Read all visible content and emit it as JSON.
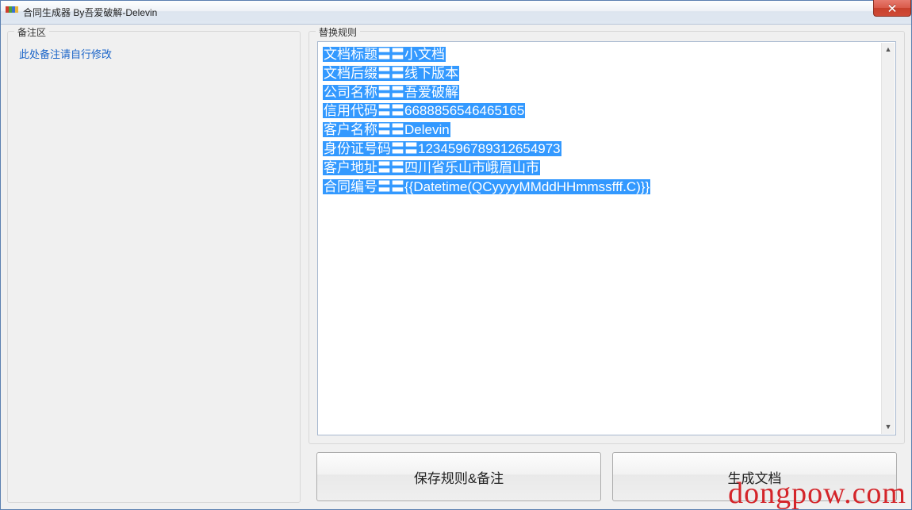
{
  "window": {
    "title": "合同生成器    By吾爱破解-Delevin"
  },
  "left": {
    "legend": "备注区",
    "notes_placeholder": "此处备注请自行修改"
  },
  "right": {
    "legend": "替换规则",
    "rules_lines": [
      "文档标题〓〓小文档",
      "文档后缀〓〓线下版本",
      "公司名称〓〓吾爱破解",
      "信用代码〓〓6688856546465165",
      "客户名称〓〓Delevin",
      "身份证号码〓〓1234596789312654973",
      "客户地址〓〓四川省乐山市峨眉山市",
      "合同编号〓〓{{Datetime(QCyyyyMMddHHmmssfff.C)}}"
    ],
    "buttons": {
      "save_label": "保存规则&备注",
      "generate_label": "生成文档"
    }
  },
  "watermark": "dongpow.com"
}
